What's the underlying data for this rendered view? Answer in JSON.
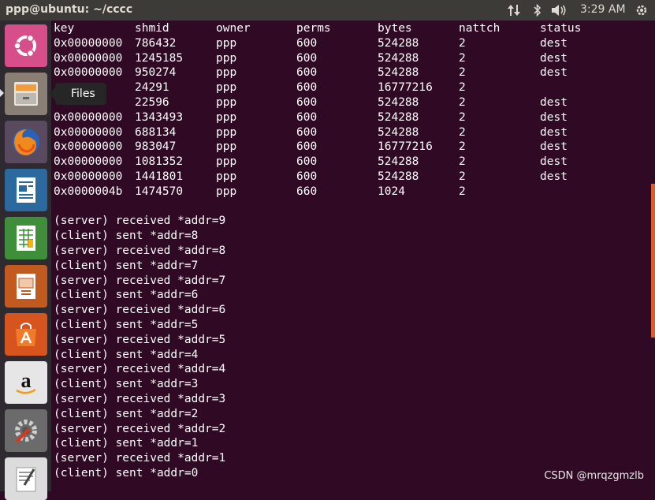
{
  "window": {
    "title": "ppp@ubuntu: ~/cccc"
  },
  "topbar": {
    "network_icon": "network-updown-icon",
    "bluetooth_icon": "bluetooth-icon",
    "volume_icon": "volume-icon",
    "clock": "3:29 AM",
    "settings_icon": "power-gear-icon"
  },
  "launcher": {
    "tooltip": "Files",
    "items": [
      {
        "name": "ubuntu-dash"
      },
      {
        "name": "files"
      },
      {
        "name": "firefox"
      },
      {
        "name": "libreoffice-writer"
      },
      {
        "name": "libreoffice-calc"
      },
      {
        "name": "libreoffice-impress"
      },
      {
        "name": "ubuntu-software"
      },
      {
        "name": "amazon"
      },
      {
        "name": "system-settings"
      },
      {
        "name": "text-editor"
      }
    ]
  },
  "table": {
    "headers": [
      "key",
      "shmid",
      "owner",
      "perms",
      "bytes",
      "nattch",
      "status"
    ],
    "rows": [
      [
        "0x00000000",
        "786432",
        "ppp",
        "600",
        "524288",
        "2",
        "dest"
      ],
      [
        "0x00000000",
        "1245185",
        "ppp",
        "600",
        "524288",
        "2",
        "dest"
      ],
      [
        "0x00000000",
        "950274",
        "ppp",
        "600",
        "524288",
        "2",
        "dest"
      ],
      [
        "",
        "24291",
        "ppp",
        "600",
        "16777216",
        "2",
        ""
      ],
      [
        "",
        "22596",
        "ppp",
        "600",
        "524288",
        "2",
        "dest"
      ],
      [
        "0x00000000",
        "1343493",
        "ppp",
        "600",
        "524288",
        "2",
        "dest"
      ],
      [
        "0x00000000",
        "688134",
        "ppp",
        "600",
        "524288",
        "2",
        "dest"
      ],
      [
        "0x00000000",
        "983047",
        "ppp",
        "600",
        "16777216",
        "2",
        "dest"
      ],
      [
        "0x00000000",
        "1081352",
        "ppp",
        "600",
        "524288",
        "2",
        "dest"
      ],
      [
        "0x00000000",
        "1441801",
        "ppp",
        "600",
        "524288",
        "2",
        "dest"
      ],
      [
        "0x0000004b",
        "1474570",
        "ppp",
        "660",
        "1024",
        "2",
        ""
      ]
    ]
  },
  "log": [
    "(server) received *addr=9",
    "(client) sent *addr=8",
    "(server) received *addr=8",
    "(client) sent *addr=7",
    "(server) received *addr=7",
    "(client) sent *addr=6",
    "(server) received *addr=6",
    "(client) sent *addr=5",
    "(server) received *addr=5",
    "(client) sent *addr=4",
    "(server) received *addr=4",
    "(client) sent *addr=3",
    "(server) received *addr=3",
    "(client) sent *addr=2",
    "(server) received *addr=2",
    "(client) sent *addr=1",
    "(server) received *addr=1",
    "(client) sent *addr=0"
  ],
  "watermark": "CSDN @mrqzgmzlb",
  "colors": {
    "terminal_bg": "#300a24",
    "panel_bg": "#3c3b37",
    "launcher_bg": "#2f2a30",
    "accent": "#e05a2a"
  }
}
